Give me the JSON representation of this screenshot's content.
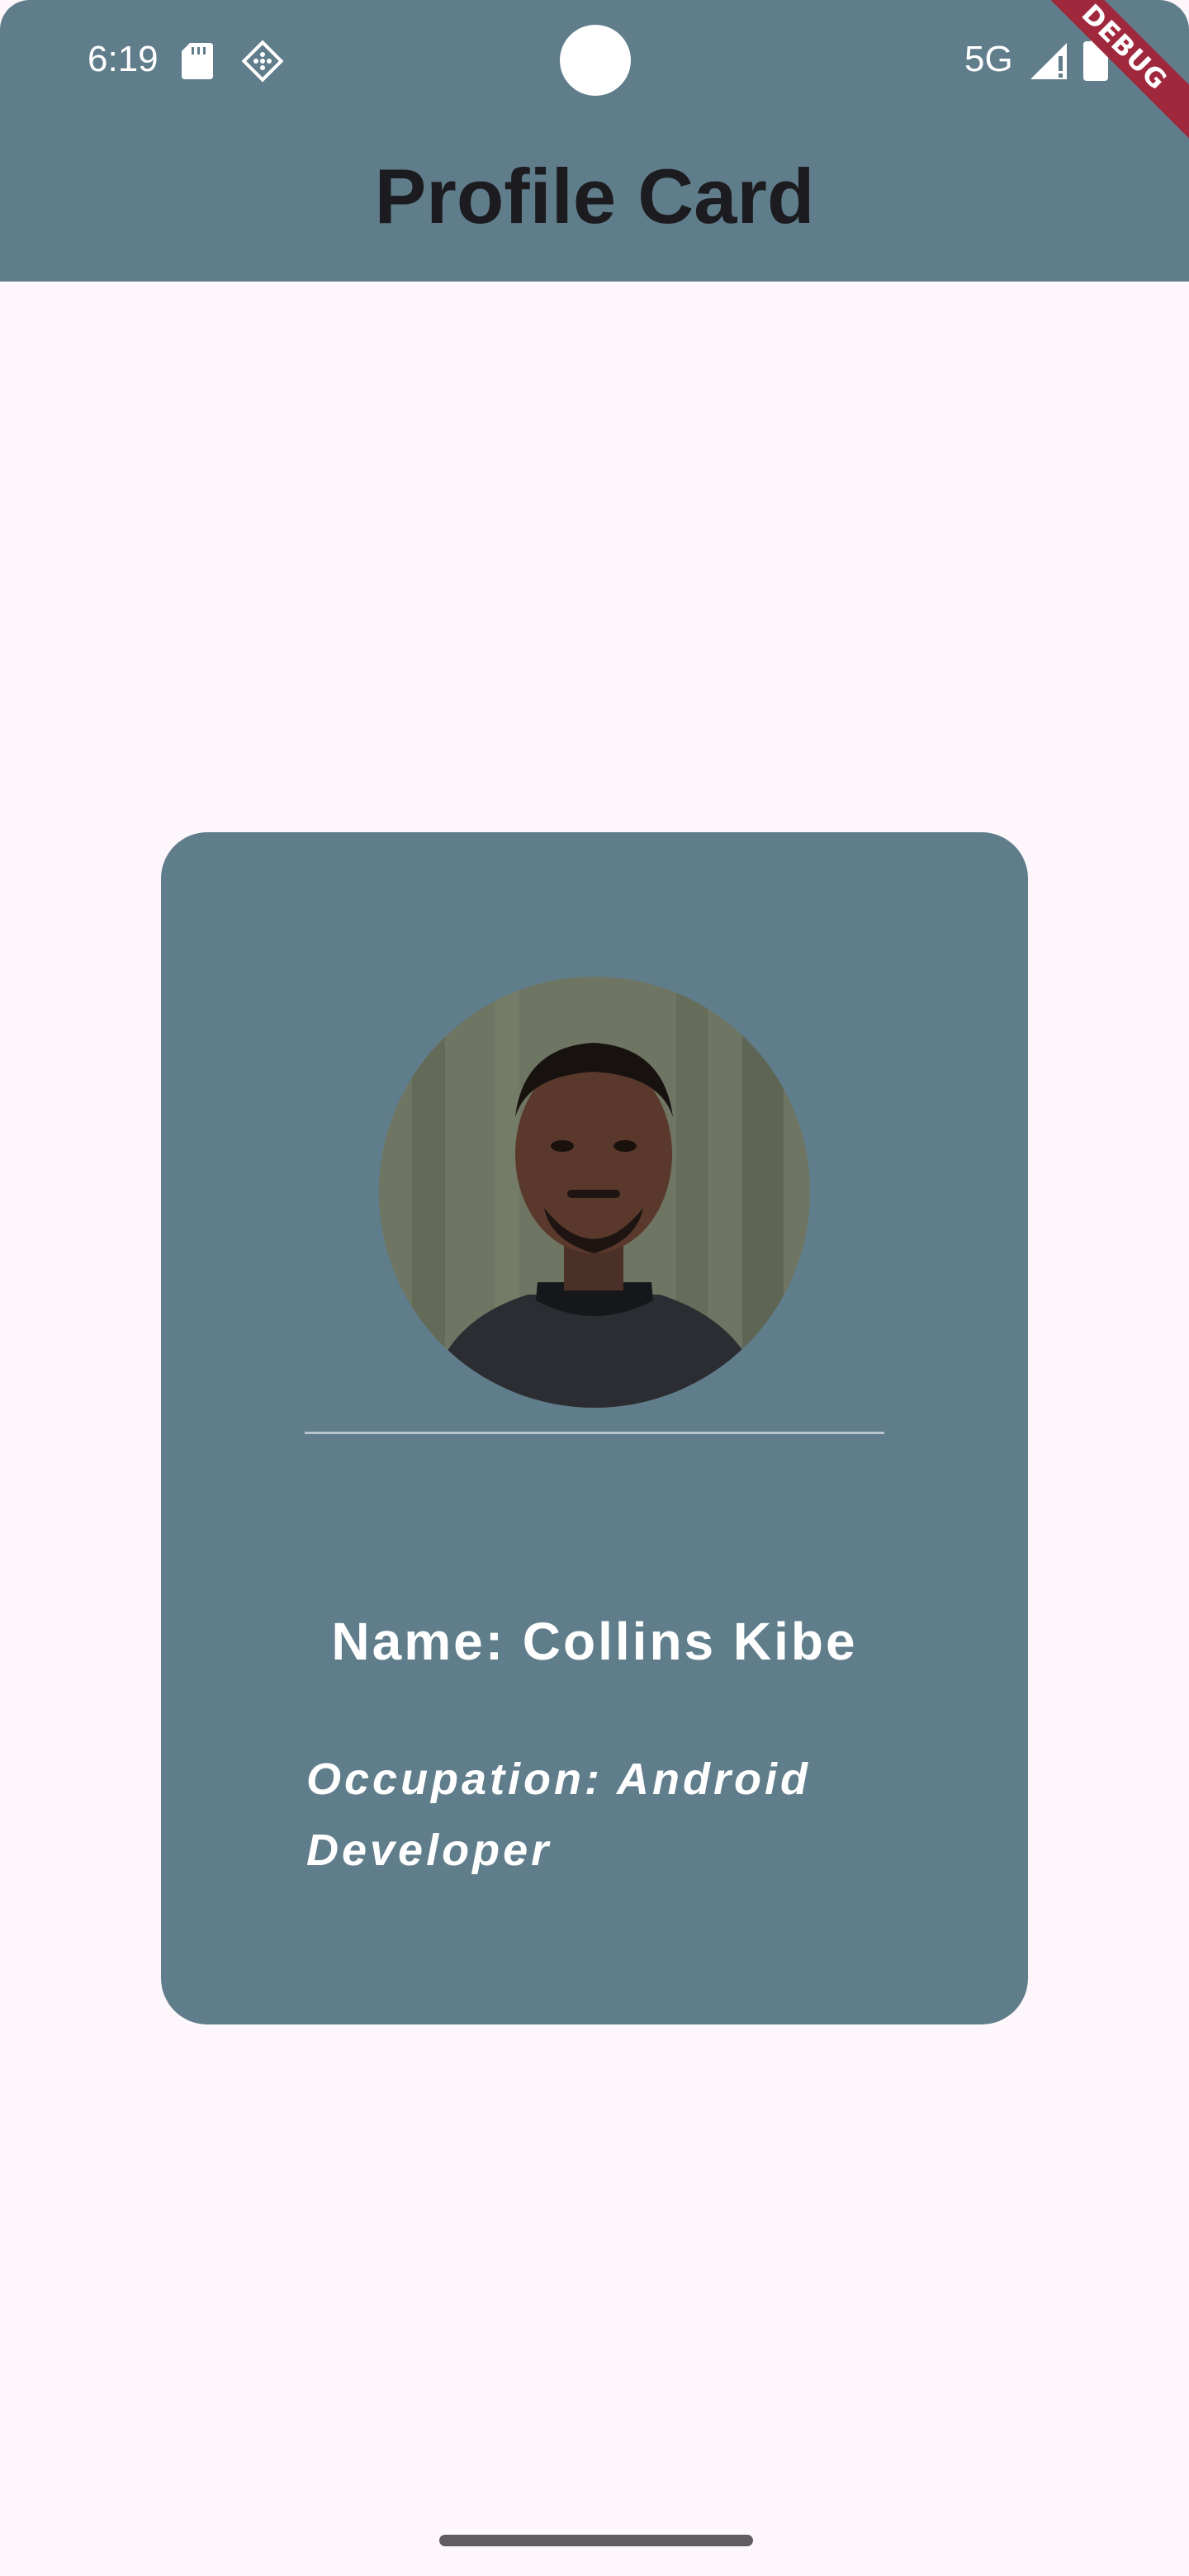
{
  "status_bar": {
    "time": "6:19",
    "network": "5G",
    "debug_banner": "DEBUG",
    "icons": [
      "sd-card-icon",
      "diamond-app-icon",
      "signal-icon",
      "battery-icon"
    ]
  },
  "app_bar": {
    "title": "Profile Card"
  },
  "profile_card": {
    "name": "Name: Collins Kibe",
    "occupation": "Occupation: Android Developer",
    "avatar_icon": "profile-photo"
  },
  "colors": {
    "app_bar": "#607D8B",
    "card": "#607D8B",
    "background": "#FDF7FC",
    "title_text": "#1C1B1F",
    "card_text": "#FFFFFF",
    "debug_ribbon": "#A0283C"
  }
}
